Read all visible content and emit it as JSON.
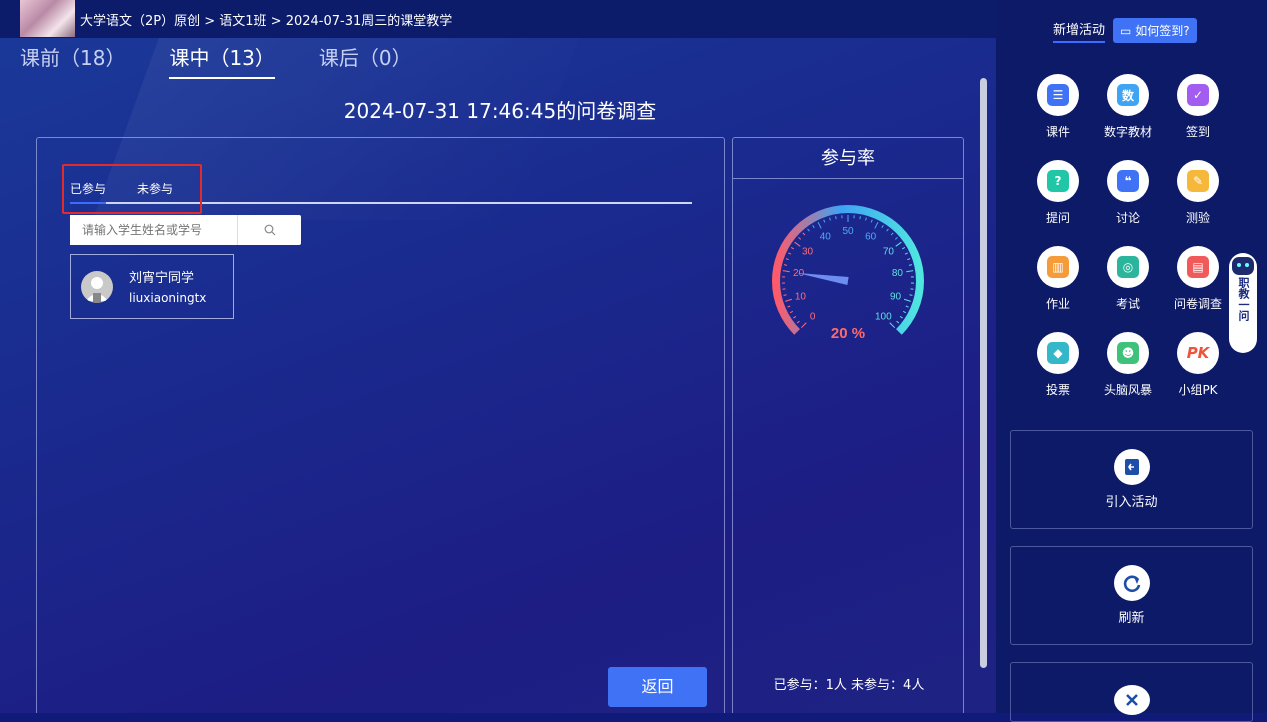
{
  "header": {
    "breadcrumb": "大学语文（2P）原创 > 语文1班 > 2024-07-31周三的课堂教学"
  },
  "tabs": [
    {
      "label": "课前（18）"
    },
    {
      "label": "课中（13）"
    },
    {
      "label": "课后（0）"
    }
  ],
  "page_title": "2024-07-31 17:46:45的问卷调查",
  "subtabs": {
    "joined": "已参与",
    "not_joined": "未参与"
  },
  "search": {
    "placeholder": "请输入学生姓名或学号"
  },
  "students": [
    {
      "name": "刘宵宁同学",
      "id": "liuxiaoningtx"
    }
  ],
  "back_label": "返回",
  "rate": {
    "title": "参与率",
    "percent": 20,
    "percent_label": "20 %",
    "ticks": [
      "0",
      "10",
      "20",
      "30",
      "40",
      "50",
      "60",
      "70",
      "80",
      "90",
      "100"
    ],
    "stats": "已参与：1人    未参与：4人"
  },
  "sidebar": {
    "new_activity": "新增活动",
    "how_signin": "如何签到?",
    "activities": [
      {
        "label": "课件",
        "icon": "courseware-icon",
        "color": "#3f72f4",
        "glyph": "☰"
      },
      {
        "label": "数字教材",
        "icon": "digital-textbook-icon",
        "color": "#3fa4f4",
        "glyph": "数"
      },
      {
        "label": "签到",
        "icon": "signin-icon",
        "color": "#a35cf0",
        "glyph": "✓"
      },
      {
        "label": "提问",
        "icon": "question-icon",
        "color": "#20c6a6",
        "glyph": "?"
      },
      {
        "label": "讨论",
        "icon": "discussion-icon",
        "color": "#3f72f4",
        "glyph": "❝"
      },
      {
        "label": "测验",
        "icon": "quiz-icon",
        "color": "#f5b83a",
        "glyph": "✎"
      },
      {
        "label": "作业",
        "icon": "homework-icon",
        "color": "#f59b3a",
        "glyph": "▥"
      },
      {
        "label": "考试",
        "icon": "exam-icon",
        "color": "#2bb59c",
        "glyph": "◎"
      },
      {
        "label": "问卷调查",
        "icon": "survey-icon",
        "color": "#f05a5a",
        "glyph": "▤"
      },
      {
        "label": "投票",
        "icon": "vote-icon",
        "color": "#34b7c9",
        "glyph": "◆"
      },
      {
        "label": "头脑风暴",
        "icon": "brainstorm-icon",
        "color": "#3ec27a",
        "glyph": "☻"
      },
      {
        "label": "小组PK",
        "icon": "group-pk-icon",
        "color": "#f0533a",
        "glyph": "PK"
      }
    ],
    "import_label": "引入活动",
    "refresh_label": "刷新",
    "robot_text": "职教一问"
  },
  "colors": {
    "accent": "#3f72f4",
    "gauge_value": "#ff6b6b",
    "highlight": "#e02c2c"
  }
}
